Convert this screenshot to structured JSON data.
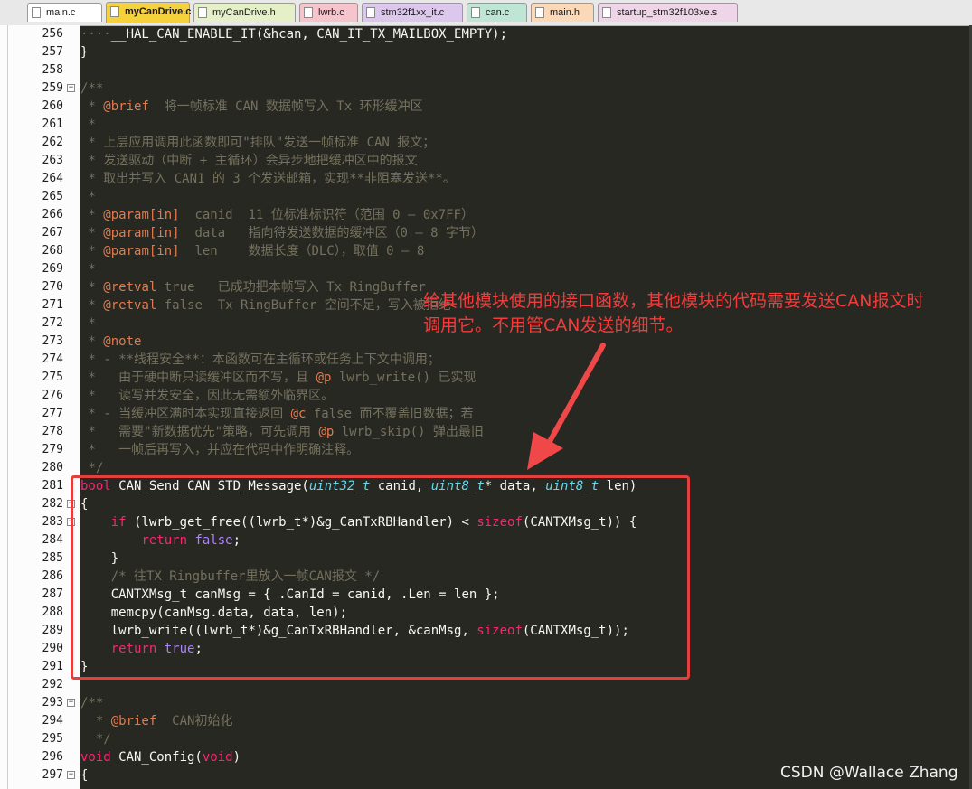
{
  "tabs": [
    {
      "label": "main.c",
      "color": "#ffffff",
      "active": false
    },
    {
      "label": "myCanDrive.c",
      "color": "#f4d13d",
      "active": true
    },
    {
      "label": "myCanDrive.h",
      "color": "#e6f0c8",
      "active": false
    },
    {
      "label": "lwrb.c",
      "color": "#f6c4cc",
      "active": false
    },
    {
      "label": "stm32f1xx_it.c",
      "color": "#dcc8ec",
      "active": false
    },
    {
      "label": "can.c",
      "color": "#bfe6d4",
      "active": false
    },
    {
      "label": "main.h",
      "color": "#fbd8b8",
      "active": false
    },
    {
      "label": "startup_stm32f103xe.s",
      "color": "#eed6e8",
      "active": false
    }
  ],
  "code_lines": [
    {
      "num": "256",
      "fold": false,
      "tokens": [
        {
          "c": "t-c",
          "s": "····"
        },
        {
          "c": "",
          "s": "__HAL_CAN_ENABLE_IT(&hcan, CAN_IT_TX_MAILBOX_EMPTY);"
        }
      ]
    },
    {
      "num": "257",
      "fold": false,
      "tokens": [
        {
          "c": "",
          "s": "}"
        }
      ]
    },
    {
      "num": "258",
      "fold": false,
      "tokens": []
    },
    {
      "num": "259",
      "fold": true,
      "tokens": [
        {
          "c": "t-c",
          "s": "/**"
        }
      ]
    },
    {
      "num": "260",
      "fold": false,
      "tokens": [
        {
          "c": "t-c",
          "s": " * "
        },
        {
          "c": "t-tag",
          "s": "@brief"
        },
        {
          "c": "t-c",
          "s": "  将一帧标准 CAN 数据帧写入 Tx 环形缓冲区"
        }
      ]
    },
    {
      "num": "261",
      "fold": false,
      "tokens": [
        {
          "c": "t-c",
          "s": " *"
        }
      ]
    },
    {
      "num": "262",
      "fold": false,
      "tokens": [
        {
          "c": "t-c",
          "s": " * 上层应用调用此函数即可\"排队\"发送一帧标准 CAN 报文；"
        }
      ]
    },
    {
      "num": "263",
      "fold": false,
      "tokens": [
        {
          "c": "t-c",
          "s": " * 发送驱动（中断 + 主循环）会异步地把缓冲区中的报文"
        }
      ]
    },
    {
      "num": "264",
      "fold": false,
      "tokens": [
        {
          "c": "t-c",
          "s": " * 取出并写入 CAN1 的 3 个发送邮箱，实现**非阻塞发送**。"
        }
      ]
    },
    {
      "num": "265",
      "fold": false,
      "tokens": [
        {
          "c": "t-c",
          "s": " *"
        }
      ]
    },
    {
      "num": "266",
      "fold": false,
      "tokens": [
        {
          "c": "t-c",
          "s": " * "
        },
        {
          "c": "t-tag",
          "s": "@param[in]"
        },
        {
          "c": "t-c",
          "s": "  canid  11 位标准标识符（范围 0 – 0x7FF）"
        }
      ]
    },
    {
      "num": "267",
      "fold": false,
      "tokens": [
        {
          "c": "t-c",
          "s": " * "
        },
        {
          "c": "t-tag",
          "s": "@param[in]"
        },
        {
          "c": "t-c",
          "s": "  data   指向待发送数据的缓冲区（0 – 8 字节）"
        }
      ]
    },
    {
      "num": "268",
      "fold": false,
      "tokens": [
        {
          "c": "t-c",
          "s": " * "
        },
        {
          "c": "t-tag",
          "s": "@param[in]"
        },
        {
          "c": "t-c",
          "s": "  len    数据长度（DLC），取值 0 – 8"
        }
      ]
    },
    {
      "num": "269",
      "fold": false,
      "tokens": [
        {
          "c": "t-c",
          "s": " *"
        }
      ]
    },
    {
      "num": "270",
      "fold": false,
      "tokens": [
        {
          "c": "t-c",
          "s": " * "
        },
        {
          "c": "t-tag",
          "s": "@retval"
        },
        {
          "c": "t-c",
          "s": " true   已成功把本帧写入 Tx RingBuffer"
        }
      ]
    },
    {
      "num": "271",
      "fold": false,
      "tokens": [
        {
          "c": "t-c",
          "s": " * "
        },
        {
          "c": "t-tag",
          "s": "@retval"
        },
        {
          "c": "t-c",
          "s": " false  Tx RingBuffer 空间不足，写入被拒绝"
        }
      ]
    },
    {
      "num": "272",
      "fold": false,
      "tokens": [
        {
          "c": "t-c",
          "s": " *"
        }
      ]
    },
    {
      "num": "273",
      "fold": false,
      "tokens": [
        {
          "c": "t-c",
          "s": " * "
        },
        {
          "c": "t-tag",
          "s": "@note"
        }
      ]
    },
    {
      "num": "274",
      "fold": false,
      "tokens": [
        {
          "c": "t-c",
          "s": " * - **线程安全**：本函数可在主循环或任务上下文中调用；"
        }
      ]
    },
    {
      "num": "275",
      "fold": false,
      "tokens": [
        {
          "c": "t-c",
          "s": " *   由于硬中断只读缓冲区而不写，且 "
        },
        {
          "c": "t-tag",
          "s": "@p"
        },
        {
          "c": "t-c",
          "s": " lwrb_write() 已实现"
        }
      ]
    },
    {
      "num": "276",
      "fold": false,
      "tokens": [
        {
          "c": "t-c",
          "s": " *   读写并发安全，因此无需额外临界区。"
        }
      ]
    },
    {
      "num": "277",
      "fold": false,
      "tokens": [
        {
          "c": "t-c",
          "s": " * - 当缓冲区满时本实现直接返回 "
        },
        {
          "c": "t-tag",
          "s": "@c"
        },
        {
          "c": "t-c",
          "s": " false 而不覆盖旧数据；若"
        }
      ]
    },
    {
      "num": "278",
      "fold": false,
      "tokens": [
        {
          "c": "t-c",
          "s": " *   需要\"新数据优先\"策略，可先调用 "
        },
        {
          "c": "t-tag",
          "s": "@p"
        },
        {
          "c": "t-c",
          "s": " lwrb_skip() 弹出最旧"
        }
      ]
    },
    {
      "num": "279",
      "fold": false,
      "tokens": [
        {
          "c": "t-c",
          "s": " *   一帧后再写入，并应在代码中作明确注释。"
        }
      ]
    },
    {
      "num": "280",
      "fold": false,
      "tokens": [
        {
          "c": "t-c",
          "s": " */"
        }
      ]
    },
    {
      "num": "281",
      "fold": false,
      "tokens": [
        {
          "c": "t-k",
          "s": "bool"
        },
        {
          "c": "",
          "s": " CAN_Send_CAN_STD_Message("
        },
        {
          "c": "t-t",
          "s": "uint32_t"
        },
        {
          "c": "",
          "s": " canid, "
        },
        {
          "c": "t-t",
          "s": "uint8_t"
        },
        {
          "c": "",
          "s": "* data, "
        },
        {
          "c": "t-t",
          "s": "uint8_t"
        },
        {
          "c": "",
          "s": " len)"
        }
      ]
    },
    {
      "num": "282",
      "fold": true,
      "tokens": [
        {
          "c": "",
          "s": "{"
        }
      ]
    },
    {
      "num": "283",
      "fold": true,
      "tokens": [
        {
          "c": "t-c",
          "s": "    "
        },
        {
          "c": "t-k",
          "s": "if"
        },
        {
          "c": "",
          "s": " (lwrb_get_free((lwrb_t*)&g_CanTxRBHandler) < "
        },
        {
          "c": "t-k",
          "s": "sizeof"
        },
        {
          "c": "",
          "s": "(CANTXMsg_t)) {"
        }
      ]
    },
    {
      "num": "284",
      "fold": false,
      "tokens": [
        {
          "c": "t-c",
          "s": "        "
        },
        {
          "c": "t-k",
          "s": "return"
        },
        {
          "c": "",
          "s": " "
        },
        {
          "c": "t-n",
          "s": "false"
        },
        {
          "c": "",
          "s": ";"
        }
      ]
    },
    {
      "num": "285",
      "fold": false,
      "tokens": [
        {
          "c": "t-c",
          "s": "    "
        },
        {
          "c": "",
          "s": "}"
        }
      ]
    },
    {
      "num": "286",
      "fold": false,
      "tokens": [
        {
          "c": "t-c",
          "s": "    /* 往TX Ringbuffer里放入一帧CAN报文 */"
        }
      ]
    },
    {
      "num": "287",
      "fold": false,
      "tokens": [
        {
          "c": "t-c",
          "s": "    "
        },
        {
          "c": "",
          "s": "CANTXMsg_t canMsg = { .CanId = canid, .Len = len };"
        }
      ]
    },
    {
      "num": "288",
      "fold": false,
      "tokens": [
        {
          "c": "t-c",
          "s": "    "
        },
        {
          "c": "",
          "s": "memcpy(canMsg.data, data, len);"
        }
      ]
    },
    {
      "num": "289",
      "fold": false,
      "tokens": [
        {
          "c": "t-c",
          "s": "    "
        },
        {
          "c": "",
          "s": "lwrb_write((lwrb_t*)&g_CanTxRBHandler, &canMsg, "
        },
        {
          "c": "t-k",
          "s": "sizeof"
        },
        {
          "c": "",
          "s": "(CANTXMsg_t));"
        }
      ]
    },
    {
      "num": "290",
      "fold": false,
      "tokens": [
        {
          "c": "t-c",
          "s": "    "
        },
        {
          "c": "t-k",
          "s": "return"
        },
        {
          "c": "",
          "s": " "
        },
        {
          "c": "t-n",
          "s": "true"
        },
        {
          "c": "",
          "s": ";"
        }
      ]
    },
    {
      "num": "291",
      "fold": false,
      "tokens": [
        {
          "c": "",
          "s": "}"
        }
      ]
    },
    {
      "num": "292",
      "fold": false,
      "tokens": []
    },
    {
      "num": "293",
      "fold": true,
      "tokens": [
        {
          "c": "t-c",
          "s": "/**"
        }
      ]
    },
    {
      "num": "294",
      "fold": false,
      "tokens": [
        {
          "c": "t-c",
          "s": "  * "
        },
        {
          "c": "t-tag",
          "s": "@brief"
        },
        {
          "c": "t-c",
          "s": "  CAN初始化"
        }
      ]
    },
    {
      "num": "295",
      "fold": false,
      "tokens": [
        {
          "c": "t-c",
          "s": "  */"
        }
      ]
    },
    {
      "num": "296",
      "fold": false,
      "tokens": [
        {
          "c": "t-k",
          "s": "void"
        },
        {
          "c": "",
          "s": " CAN_Config("
        },
        {
          "c": "t-k",
          "s": "void"
        },
        {
          "c": "",
          "s": ")"
        }
      ]
    },
    {
      "num": "297",
      "fold": true,
      "tokens": [
        {
          "c": "",
          "s": "{"
        }
      ]
    }
  ],
  "annotation": {
    "line1": "给其他模块使用的接口函数，其他模块的代码需要发送CAN报文时",
    "line2": "调用它。不用管CAN发送的细节。",
    "color": "#f23b3b"
  },
  "watermark": "CSDN @Wallace Zhang",
  "theme": {
    "editor_bg": "#272822",
    "comment": "#75715e",
    "keyword": "#f92672",
    "type": "#66d9ef",
    "highlight": "#e2403f"
  }
}
